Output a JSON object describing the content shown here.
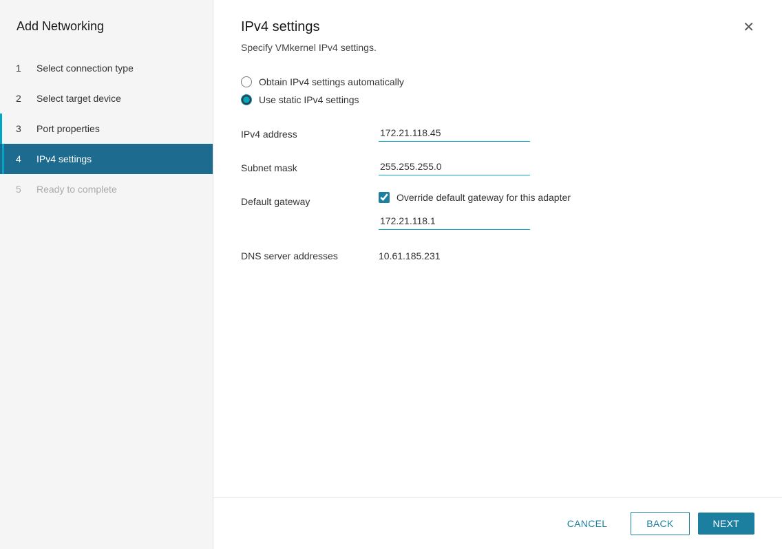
{
  "modal": {
    "title": "Add Networking"
  },
  "sidebar": {
    "steps": [
      {
        "id": "step-1",
        "number": "1",
        "label": "Select connection type",
        "state": "completed"
      },
      {
        "id": "step-2",
        "number": "2",
        "label": "Select target device",
        "state": "completed"
      },
      {
        "id": "step-3",
        "number": "3",
        "label": "Port properties",
        "state": "completed"
      },
      {
        "id": "step-4",
        "number": "4",
        "label": "IPv4 settings",
        "state": "active"
      },
      {
        "id": "step-5",
        "number": "5",
        "label": "Ready to complete",
        "state": "disabled"
      }
    ]
  },
  "content": {
    "title": "IPv4 settings",
    "subtitle": "Specify VMkernel IPv4 settings.",
    "radio_options": [
      {
        "id": "obtain-auto",
        "label": "Obtain IPv4 settings automatically",
        "checked": false
      },
      {
        "id": "use-static",
        "label": "Use static IPv4 settings",
        "checked": true
      }
    ],
    "fields": {
      "ipv4_address": {
        "label": "IPv4 address",
        "value": "172.21.118.45"
      },
      "subnet_mask": {
        "label": "Subnet mask",
        "value": "255.255.255.0"
      },
      "default_gateway": {
        "label": "Default gateway",
        "checkbox_label": "Override default gateway for this adapter",
        "checkbox_checked": true,
        "gateway_value": "172.21.118.1"
      },
      "dns_server": {
        "label": "DNS server addresses",
        "value": "10.61.185.231"
      }
    }
  },
  "footer": {
    "cancel_label": "CANCEL",
    "back_label": "BACK",
    "next_label": "NEXT"
  },
  "icons": {
    "close": "✕"
  }
}
